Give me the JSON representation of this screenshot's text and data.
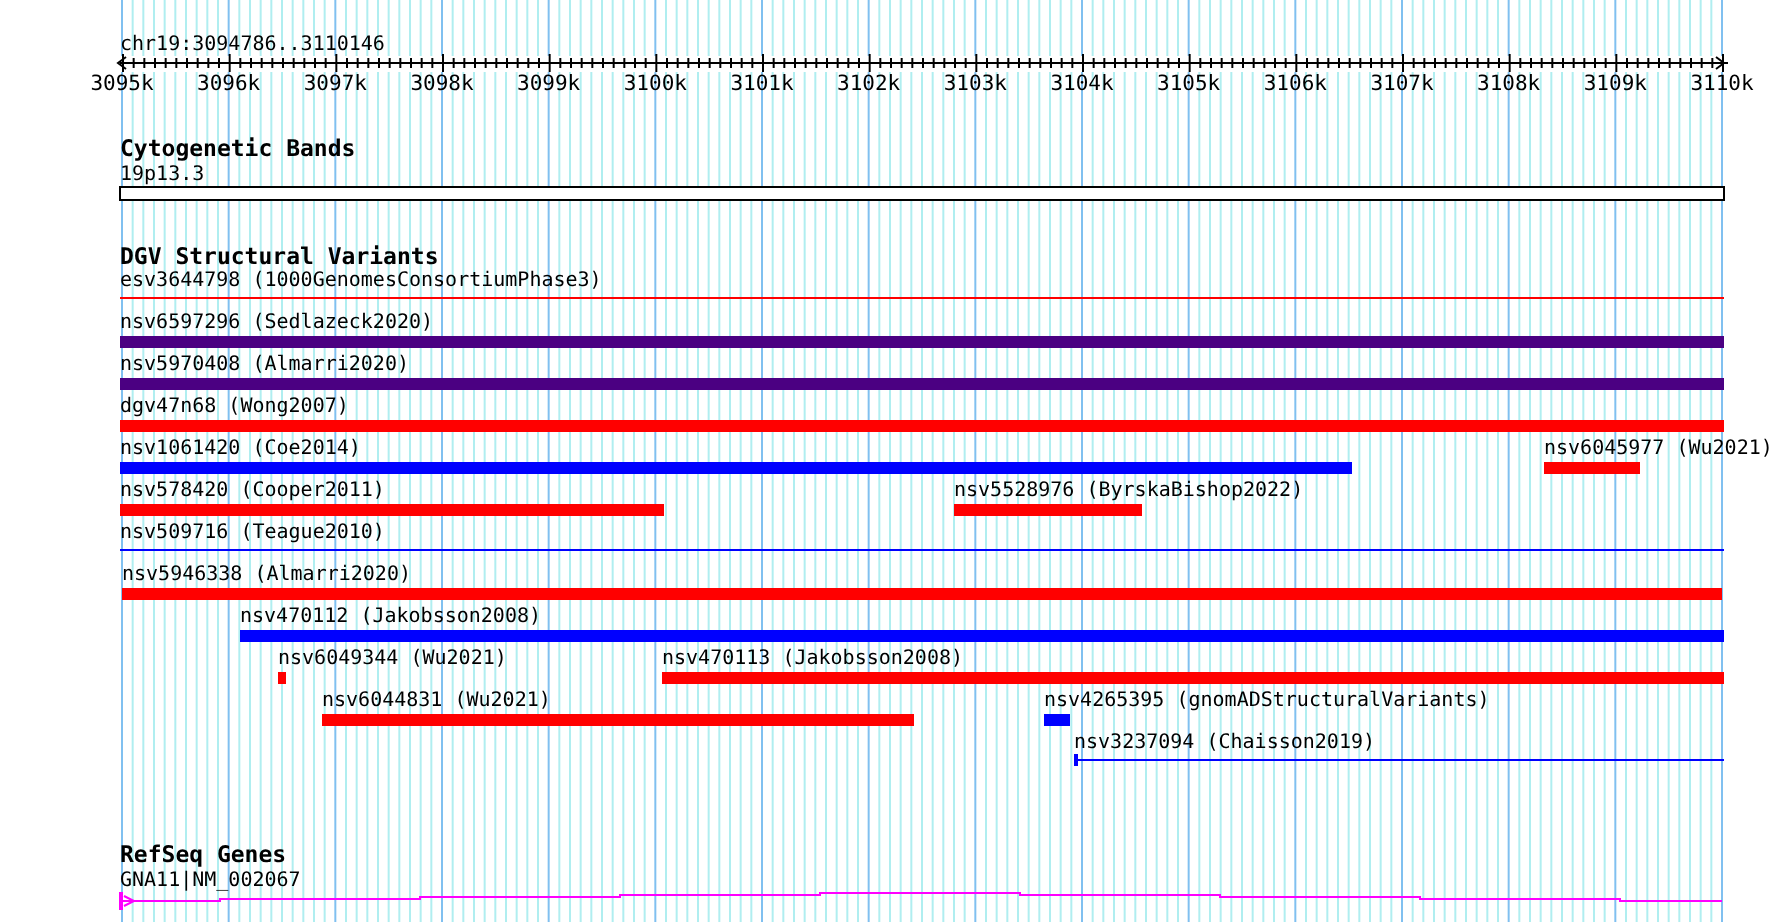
{
  "ruler": {
    "location": "chr19:3094786..3110146",
    "ticks": [
      "3095k",
      "3096k",
      "3097k",
      "3098k",
      "3099k",
      "3100k",
      "3101k",
      "3102k",
      "3103k",
      "3104k",
      "3105k",
      "3106k",
      "3107k",
      "3108k",
      "3109k",
      "3110k"
    ]
  },
  "cytoband_track": {
    "title": "Cytogenetic Bands",
    "band": "19p13.3"
  },
  "dgv_track": {
    "title": "DGV Structural Variants",
    "rows": [
      {
        "features": [
          {
            "label": "esv3644798 (1000GenomesConsortiumPhase3)",
            "kind": "line",
            "color": "#ff0000"
          }
        ]
      },
      {
        "features": [
          {
            "label": "nsv6597296 (Sedlazeck2020)",
            "kind": "bar",
            "color": "#4b0082"
          }
        ]
      },
      {
        "features": [
          {
            "label": "nsv5970408 (Almarri2020)",
            "kind": "bar",
            "color": "#4b0082"
          }
        ]
      },
      {
        "features": [
          {
            "label": "dgv47n68 (Wong2007)",
            "kind": "bar",
            "color": "#ff0000"
          }
        ]
      },
      {
        "features": [
          {
            "label": "nsv1061420 (Coe2014)",
            "kind": "bar",
            "color": "#0000ff"
          },
          {
            "label": "nsv6045977 (Wu2021)",
            "kind": "bar",
            "color": "#ff0000"
          }
        ]
      },
      {
        "features": [
          {
            "label": "nsv578420 (Cooper2011)",
            "kind": "bar",
            "color": "#ff0000"
          },
          {
            "label": "nsv5528976 (ByrskaBishop2022)",
            "kind": "bar",
            "color": "#ff0000"
          }
        ]
      },
      {
        "features": [
          {
            "label": "nsv509716 (Teague2010)",
            "kind": "line",
            "color": "#0000ff"
          }
        ]
      },
      {
        "features": [
          {
            "label": "nsv5946338 (Almarri2020)",
            "kind": "bar",
            "color": "#ff0000"
          }
        ]
      },
      {
        "features": [
          {
            "label": "nsv470112 (Jakobsson2008)",
            "kind": "bar",
            "color": "#0000ff"
          }
        ]
      },
      {
        "features": [
          {
            "label": "nsv6049344 (Wu2021)",
            "kind": "bar",
            "color": "#ff0000"
          },
          {
            "label": "nsv470113 (Jakobsson2008)",
            "kind": "bar",
            "color": "#ff0000"
          }
        ]
      },
      {
        "features": [
          {
            "label": "nsv6044831 (Wu2021)",
            "kind": "bar",
            "color": "#ff0000"
          },
          {
            "label": "nsv4265395 (gnomADStructuralVariants)",
            "kind": "bar",
            "color": "#0000ff"
          }
        ]
      },
      {
        "features": [
          {
            "label": "nsv3237094 (Chaisson2019)",
            "kind": "line",
            "color": "#0000ff"
          }
        ]
      }
    ]
  },
  "refseq_track": {
    "title": "RefSeq Genes",
    "gene": "GNA11|NM_002067"
  }
}
